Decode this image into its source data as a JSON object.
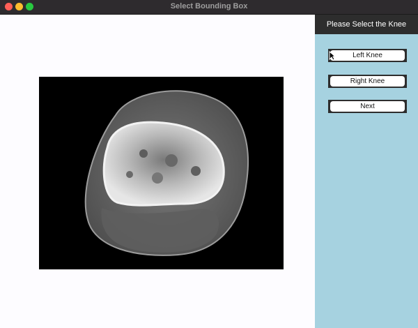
{
  "window": {
    "title": "Select Bounding Box"
  },
  "sidebar": {
    "header": "Please Select the Knee",
    "buttons": [
      {
        "label": "Left Knee"
      },
      {
        "label": "Right Knee"
      },
      {
        "label": "Next"
      }
    ]
  },
  "scan": {
    "description_icon": "ct-scan-image"
  },
  "colors": {
    "sidebar_bg": "#a6d2e0",
    "header_bg": "#2d2d2d",
    "canvas_bg": "#fdfcff"
  }
}
